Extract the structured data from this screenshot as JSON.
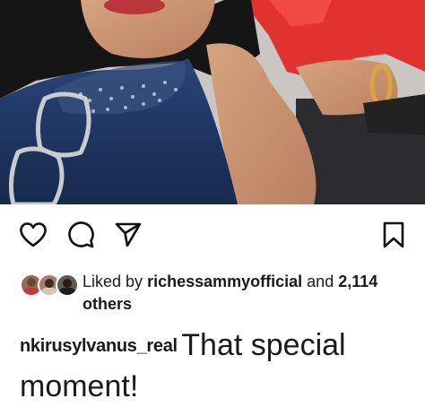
{
  "post": {
    "photo_icon": "photo-image",
    "actions": {
      "like_icon": "heart-icon",
      "comment_icon": "comment-bubble-icon",
      "share_icon": "paper-plane-icon",
      "save_icon": "bookmark-icon"
    },
    "likes": {
      "prefix": "Liked by",
      "user": "richessammyofficial",
      "and": "and",
      "count": "2,114",
      "suffix": "others"
    },
    "caption": {
      "username": "nkirusylvanus_real",
      "text": "That special moment!"
    }
  },
  "colors": {
    "text": "#1a1a1a",
    "background": "#ffffff",
    "dress": "#1f3560",
    "shirt": "#e0322e"
  }
}
